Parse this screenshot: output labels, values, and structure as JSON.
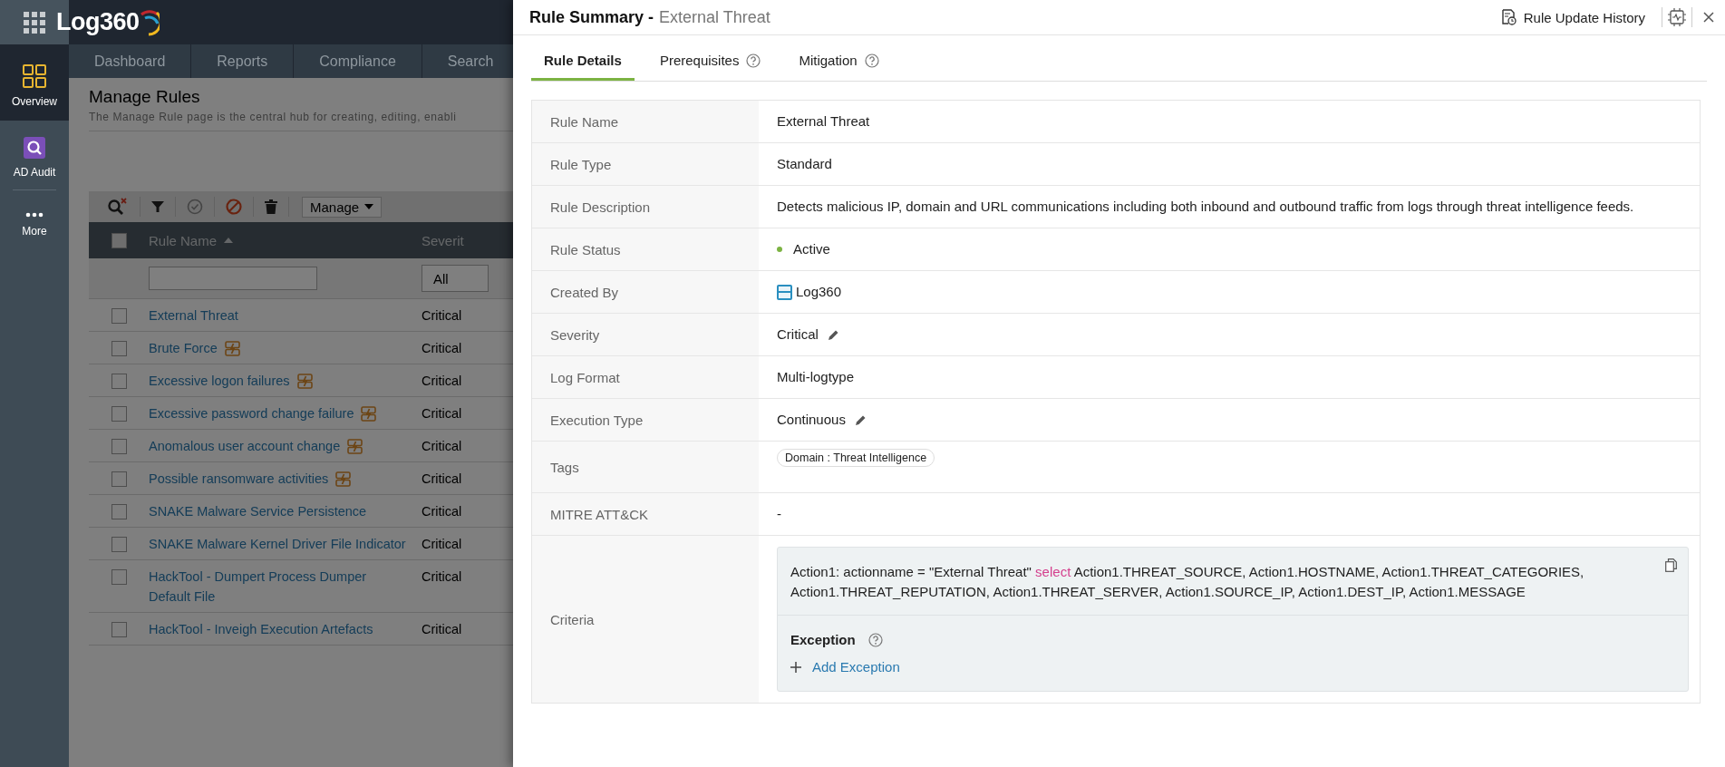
{
  "app": {
    "logo": "Log360"
  },
  "sidebar": {
    "items": [
      {
        "label": "Overview",
        "kind": "overview",
        "selected": true
      },
      {
        "label": "AD Audit",
        "kind": "audit",
        "selected": false
      },
      {
        "label": "More",
        "kind": "more",
        "selected": false
      }
    ]
  },
  "nav_tabs": [
    "Dashboard",
    "Reports",
    "Compliance",
    "Search"
  ],
  "page": {
    "title": "Manage Rules",
    "description": "The Manage Rule page is the central hub for creating, editing, enabli"
  },
  "toolbar": {
    "manage": "Manage"
  },
  "rules_table": {
    "columns": [
      "Rule Name",
      "Severit"
    ],
    "select_all_checked": false,
    "severity_filter": "All",
    "rows": [
      {
        "name": "External Threat",
        "severity": "Critical",
        "checked": false,
        "badge": false
      },
      {
        "name": "Brute Force",
        "severity": "Critical",
        "checked": false,
        "badge": true
      },
      {
        "name": "Excessive logon failures",
        "severity": "Critical",
        "checked": false,
        "badge": true
      },
      {
        "name": "Excessive password change failure",
        "severity": "Critical",
        "checked": false,
        "badge": true
      },
      {
        "name": "Anomalous user account change",
        "severity": "Critical",
        "checked": false,
        "badge": true
      },
      {
        "name": "Possible ransomware activities",
        "severity": "Critical",
        "checked": false,
        "badge": true
      },
      {
        "name": "SNAKE Malware Service Persistence",
        "severity": "Critical",
        "checked": false,
        "badge": false
      },
      {
        "name": "SNAKE Malware Kernel Driver File Indicator",
        "severity": "Critical",
        "checked": false,
        "badge": false
      },
      {
        "name": "HackTool - Dumpert Process Dumper Default File",
        "severity": "Critical",
        "checked": false,
        "badge": false
      },
      {
        "name": "HackTool - Inveigh Execution Artefacts",
        "severity": "Critical",
        "checked": false,
        "badge": false
      }
    ]
  },
  "drawer": {
    "title": "Rule Summary -",
    "subtitle": "External Threat",
    "history_button": "Rule Update History",
    "tabs": [
      {
        "label": "Rule Details",
        "selected": true,
        "help": false
      },
      {
        "label": "Prerequisites",
        "selected": false,
        "help": true
      },
      {
        "label": "Mitigation",
        "selected": false,
        "help": true
      }
    ],
    "details": [
      {
        "label": "Rule Name",
        "kind": "text",
        "value": "External Threat",
        "editable": false
      },
      {
        "label": "Rule Type",
        "kind": "text",
        "value": "Standard",
        "editable": false
      },
      {
        "label": "Rule Description",
        "kind": "text",
        "value": "Detects malicious IP, domain and URL communications including both inbound and outbound traffic from logs through threat intelligence feeds.",
        "editable": false
      },
      {
        "label": "Rule Status",
        "kind": "status",
        "value": "Active",
        "editable": false
      },
      {
        "label": "Created By",
        "kind": "creator",
        "value": "Log360",
        "editable": false
      },
      {
        "label": "Severity",
        "kind": "text",
        "value": "Critical",
        "editable": true
      },
      {
        "label": "Log Format",
        "kind": "text",
        "value": "Multi-logtype",
        "editable": false
      },
      {
        "label": "Execution Type",
        "kind": "text",
        "value": "Continuous",
        "editable": true
      },
      {
        "label": "Tags",
        "kind": "tags",
        "tags": [
          "Domain : Threat Intelligence"
        ]
      },
      {
        "label": "MITRE ATT&CK",
        "kind": "text",
        "value": "-",
        "editable": false
      },
      {
        "label": "Criteria",
        "kind": "criteria"
      }
    ],
    "criteria": {
      "condition": "Action1: actionname = \"External Threat\"",
      "keyword": "select",
      "fields": "Action1.THREAT_SOURCE, Action1.HOSTNAME, Action1.THREAT_CATEGORIES, Action1.THREAT_REPUTATION, Action1.THREAT_SERVER, Action1.SOURCE_IP, Action1.DEST_IP, Action1.MESSAGE",
      "exception_title": "Exception",
      "add_exception": "Add Exception"
    }
  }
}
